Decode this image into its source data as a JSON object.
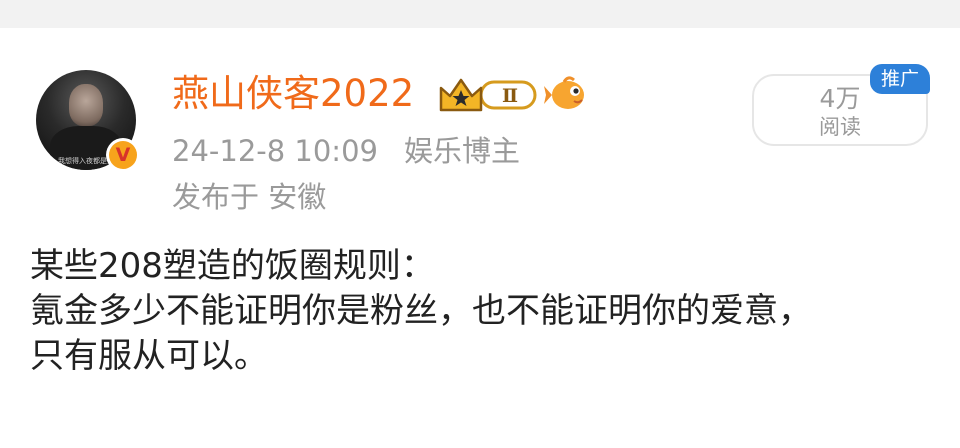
{
  "post": {
    "author": {
      "name": "燕山侠客2022",
      "avatar_caption": "我想得入夜都是空",
      "verified_badge": "V",
      "level_badge": "Ⅱ"
    },
    "timestamp": "24-12-8 10:09",
    "author_role": "娱乐博主",
    "location": "发布于 安徽",
    "stats": {
      "read_count": "4万",
      "read_label": "阅读",
      "promo_tag": "推广"
    },
    "content_lines": [
      "某些208塑造的饭圈规则：",
      "氪金多少不能证明你是粉丝，也不能证明你的爱意，",
      "只有服从可以。"
    ]
  },
  "colors": {
    "username": "#f06a1a",
    "meta_text": "#9a9a9a",
    "body_text": "#222222",
    "promo_tag_bg": "#2d80d9",
    "verified_badge_bg": "#f7a31c"
  },
  "icons": [
    "avatar",
    "verified-v-badge",
    "crown-level-badge",
    "fish-icon"
  ]
}
